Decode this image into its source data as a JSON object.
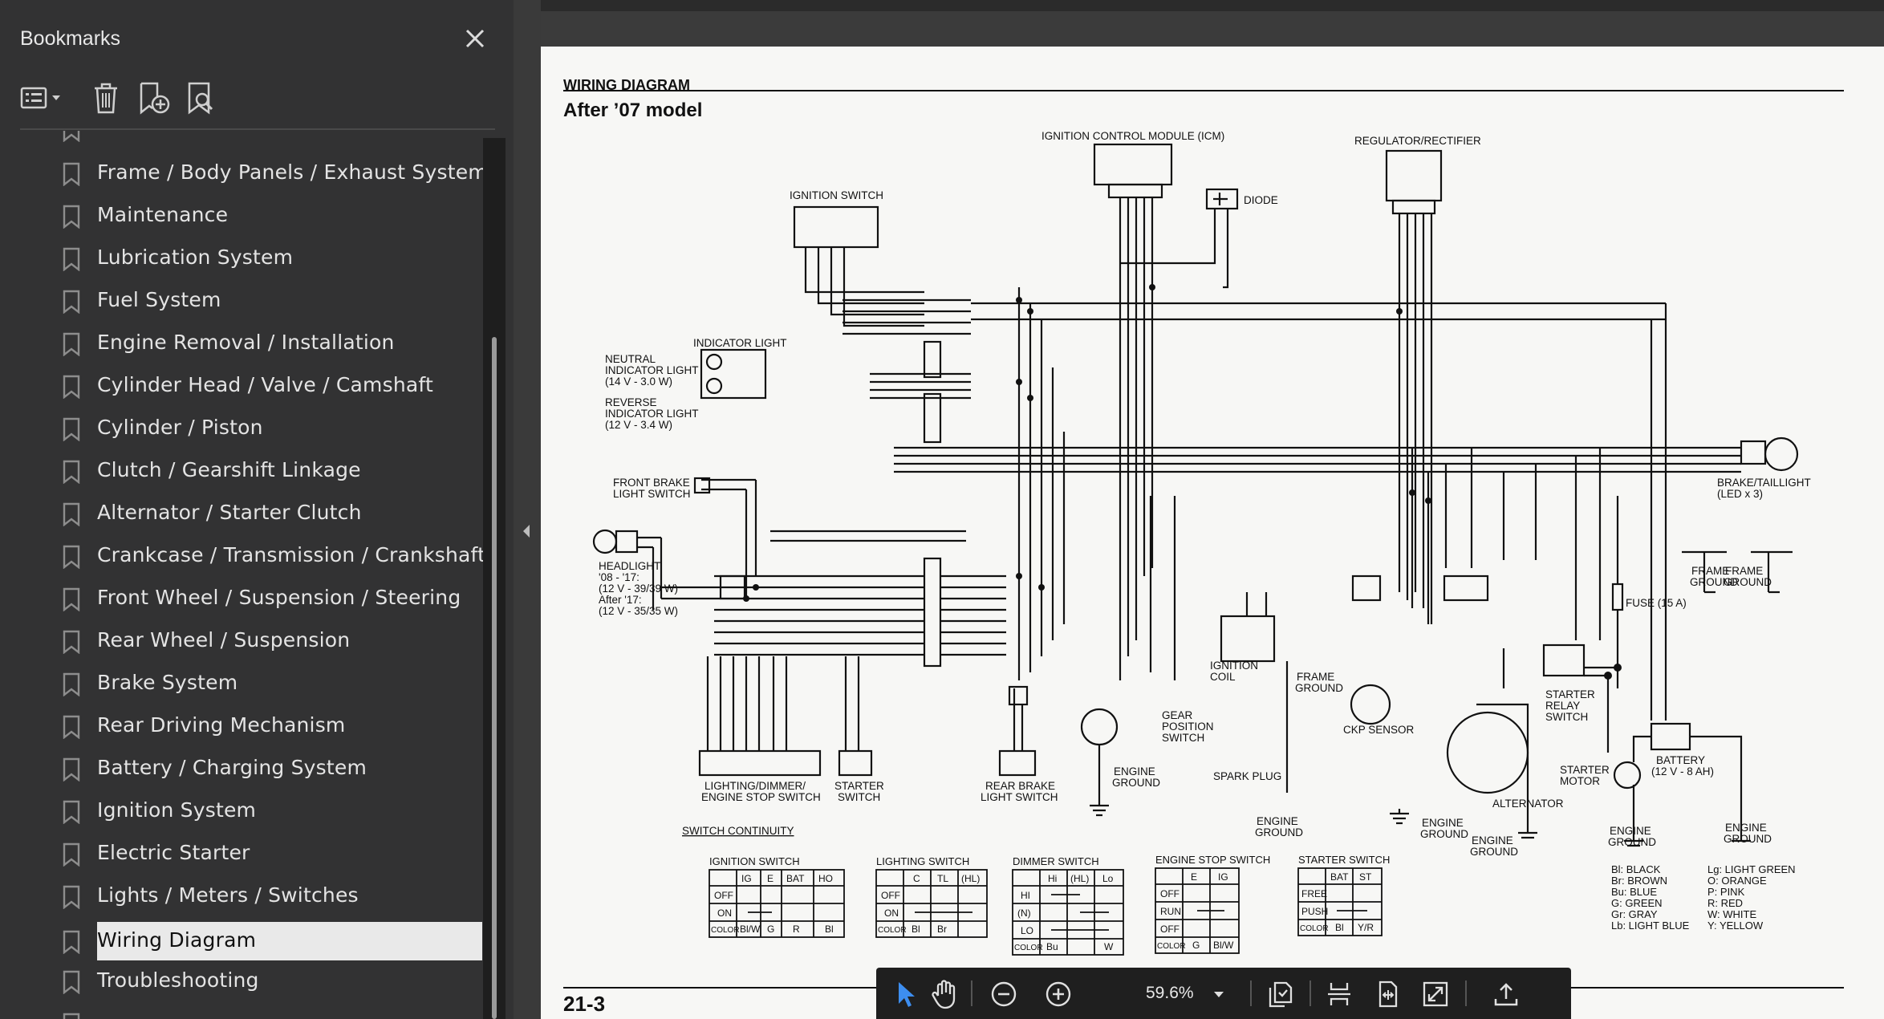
{
  "sidebar": {
    "title": "Bookmarks",
    "items": [
      {
        "label": "Frame / Body Panels / Exhaust System"
      },
      {
        "label": "Maintenance"
      },
      {
        "label": "Lubrication System"
      },
      {
        "label": "Fuel System"
      },
      {
        "label": "Engine Removal / Installation"
      },
      {
        "label": "Cylinder Head / Valve / Camshaft"
      },
      {
        "label": "Cylinder / Piston"
      },
      {
        "label": "Clutch / Gearshift Linkage"
      },
      {
        "label": "Alternator / Starter Clutch"
      },
      {
        "label": "Crankcase / Transmission / Crankshaft"
      },
      {
        "label": "Front Wheel / Suspension / Steering"
      },
      {
        "label": "Rear Wheel / Suspension"
      },
      {
        "label": "Brake System"
      },
      {
        "label": "Rear Driving Mechanism"
      },
      {
        "label": "Battery / Charging System"
      },
      {
        "label": "Ignition System"
      },
      {
        "label": "Electric Starter"
      },
      {
        "label": "Lights / Meters / Switches"
      },
      {
        "label": "Wiring Diagram",
        "active": true
      },
      {
        "label": "Troubleshooting"
      }
    ]
  },
  "page": {
    "heading": "WIRING DIAGRAM",
    "subheading": "After ’07 model",
    "page_number": "21-3",
    "labels": {
      "icm": "IGNITION CONTROL MODULE (ICM)",
      "regulator": "REGULATOR/RECTIFIER",
      "ignition_switch": "IGNITION SWITCH",
      "diode": "DIODE",
      "indicator_light": "INDICATOR LIGHT",
      "neutral_1": "NEUTRAL",
      "neutral_2": "INDICATOR LIGHT",
      "neutral_3": "(14 V - 3.0 W)",
      "reverse_1": "REVERSE",
      "reverse_2": "INDICATOR LIGHT",
      "reverse_3": "(12 V - 3.4 W)",
      "front_brake_1": "FRONT BRAKE",
      "front_brake_2": "LIGHT SWITCH",
      "headlight_1": "HEADLIGHT",
      "headlight_2": "'08 - '17:",
      "headlight_3": "(12 V - 39/39 W)",
      "headlight_4": "After '17:",
      "headlight_5": "(12 V - 35/35 W)",
      "brake_tail_1": "BRAKE/TAILLIGHT",
      "brake_tail_2": "(LED x 3)",
      "frame_ground": "FRAME",
      "ground": "GROUND",
      "fuse": "FUSE (15 A)",
      "ignition_coil_1": "IGNITION",
      "ignition_coil_2": "COIL",
      "ckp": "CKP SENSOR",
      "spark_plug": "SPARK PLUG",
      "engine_ground": "ENGINE",
      "gear_pos_1": "GEAR",
      "gear_pos_2": "POSITION",
      "gear_pos_3": "SWITCH",
      "starter_relay_1": "STARTER",
      "starter_relay_2": "RELAY",
      "starter_relay_3": "SWITCH",
      "starter_motor_1": "STARTER",
      "starter_motor_2": "MOTOR",
      "battery_1": "BATTERY",
      "battery_2": "(12 V - 8 AH)",
      "alternator": "ALTERNATOR",
      "lighting_1": "LIGHTING/DIMMER/",
      "lighting_2": "ENGINE STOP SWITCH",
      "starter_switch_1": "STARTER",
      "starter_switch_2": "SWITCH",
      "rear_brake_1": "REAR BRAKE",
      "rear_brake_2": "LIGHT SWITCH",
      "switch_continuity": "SWITCH CONTINUITY"
    },
    "continuity_tables": [
      {
        "title": "IGNITION SWITCH",
        "cols": [
          "",
          "IG",
          "E",
          "BAT",
          "HO"
        ],
        "rows": [
          "OFF",
          "ON",
          "COLOR"
        ],
        "colors": [
          "Bl/W",
          "G",
          "R",
          "Bl"
        ]
      },
      {
        "title": "LIGHTING SWITCH",
        "cols": [
          "",
          "C",
          "TL",
          "(HL)"
        ],
        "rows": [
          "OFF",
          "ON",
          "COLOR"
        ],
        "colors": [
          "Bl",
          "Br",
          ""
        ]
      },
      {
        "title": "DIMMER SWITCH",
        "cols": [
          "",
          "Hi",
          "(HL)",
          "Lo"
        ],
        "rows": [
          "HI",
          "(N)",
          "LO",
          "COLOR"
        ],
        "colors": [
          "Bu",
          "",
          "W"
        ]
      },
      {
        "title": "ENGINE STOP SWITCH",
        "cols": [
          "",
          "E",
          "IG"
        ],
        "rows": [
          "OFF",
          "RUN",
          "OFF",
          "COLOR"
        ],
        "colors": [
          "G",
          "Bl/W"
        ]
      },
      {
        "title": "STARTER SWITCH",
        "cols": [
          "",
          "BAT",
          "ST"
        ],
        "rows": [
          "FREE",
          "PUSH",
          "COLOR"
        ],
        "colors": [
          "Bl",
          "Y/R"
        ]
      }
    ],
    "color_key": [
      "Bl: BLACK",
      "Br: BROWN",
      "Bu: BLUE",
      "G: GREEN",
      "Gr: GRAY",
      "Lb: LIGHT BLUE",
      "Lg: LIGHT GREEN",
      "O: ORANGE",
      "P: PINK",
      "R: RED",
      "W: WHITE",
      "Y: YELLOW"
    ]
  },
  "toolbar": {
    "zoom": "59.6%"
  },
  "icons": {
    "close": "close-icon",
    "options": "bookmark-options-icon",
    "delete": "trash-icon",
    "add": "add-bookmark-icon",
    "find": "find-bookmark-icon",
    "select": "select-cursor-icon",
    "hand": "hand-icon",
    "zoom_out": "zoom-out-icon",
    "zoom_in": "zoom-in-icon"
  }
}
